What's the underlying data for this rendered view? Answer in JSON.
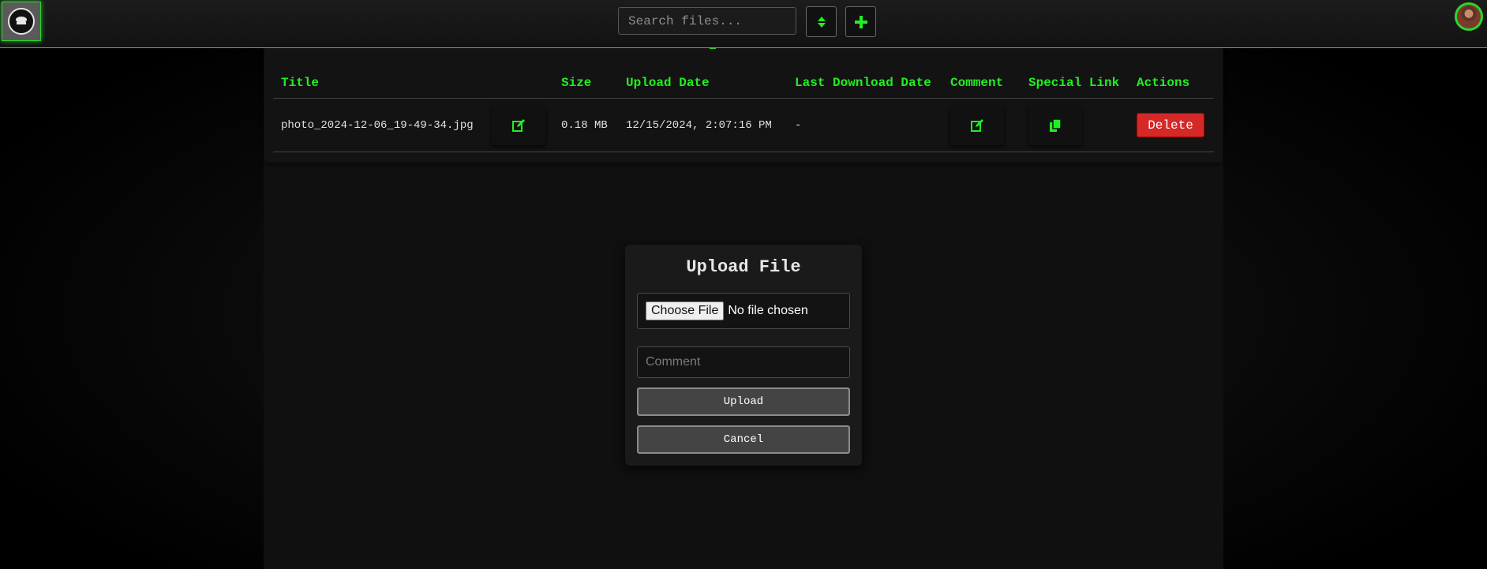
{
  "header": {
    "search_placeholder": "Search files...",
    "sort_icon": "sort-icon",
    "add_icon": "plus-icon",
    "accent_color": "#22ee22"
  },
  "table": {
    "columns": [
      "Title",
      "Size",
      "Upload Date",
      "Last Download Date",
      "Comment",
      "Special Link",
      "Actions"
    ],
    "rows": [
      {
        "title": "photo_2024-12-06_19-49-34.jpg",
        "size": "0.18 MB",
        "upload_date": "12/15/2024, 2:07:16 PM",
        "last_download_date": "-",
        "delete_label": "Delete"
      }
    ]
  },
  "modal": {
    "title": "Upload File",
    "choose_file_label": "Choose File",
    "no_file_text": "No file chosen",
    "comment_placeholder": "Comment",
    "upload_label": "Upload",
    "cancel_label": "Cancel"
  },
  "colors": {
    "delete": "#d62828",
    "accent": "#22ee22"
  }
}
